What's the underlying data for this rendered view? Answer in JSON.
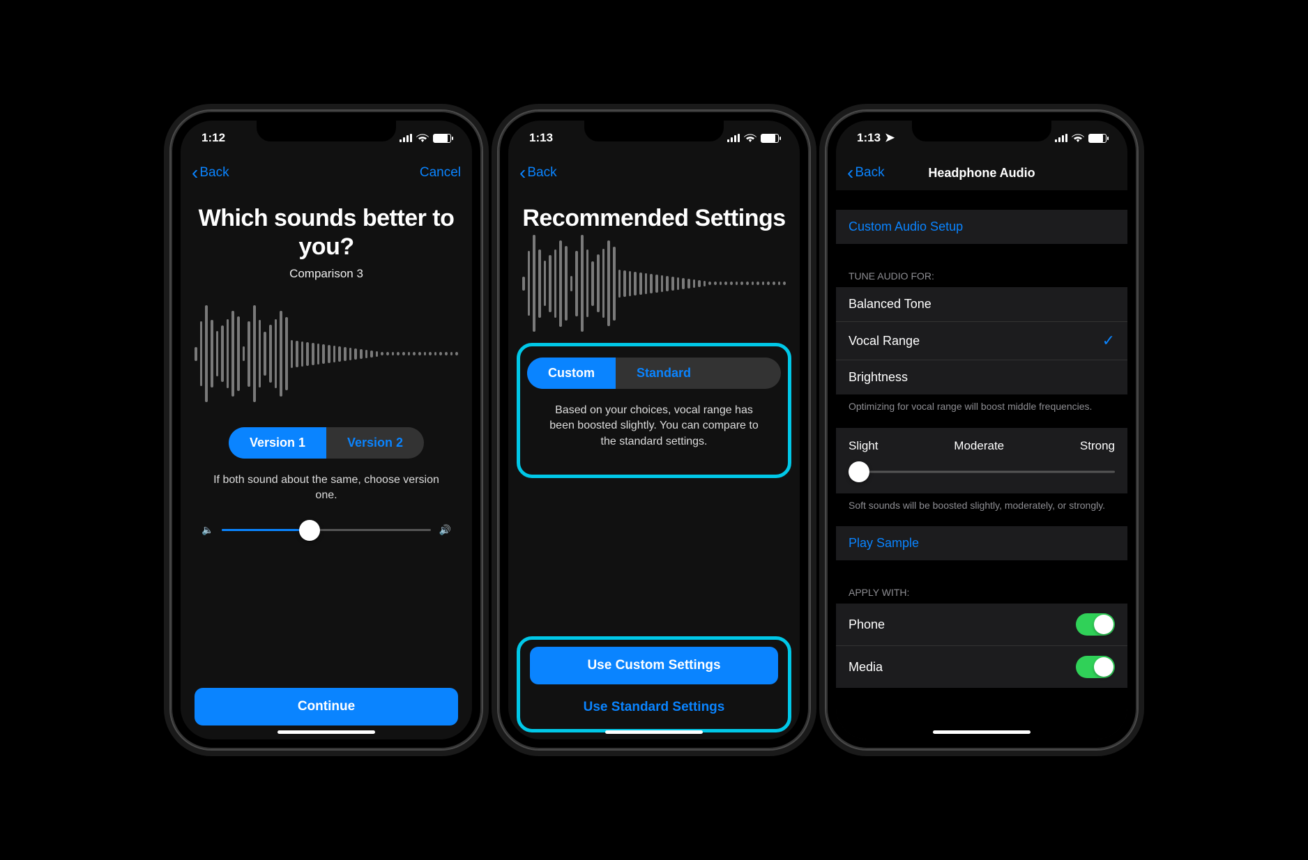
{
  "screen1": {
    "time": "1:12",
    "back": "Back",
    "cancel": "Cancel",
    "title": "Which sounds better to you?",
    "subtitle": "Comparison 3",
    "seg_a": "Version 1",
    "seg_b": "Version 2",
    "hint": "If both sound about the same, choose version one.",
    "volume_percent": 42,
    "continue": "Continue"
  },
  "screen2": {
    "time": "1:13",
    "back": "Back",
    "title": "Recommended Settings",
    "seg_a": "Custom",
    "seg_b": "Standard",
    "desc": "Based on your choices, vocal range has been boosted slightly. You can compare to the standard settings.",
    "btn_primary": "Use Custom Settings",
    "btn_secondary": "Use Standard Settings"
  },
  "screen3": {
    "time": "1:13",
    "back": "Back",
    "title": "Headphone Audio",
    "custom_setup": "Custom Audio Setup",
    "tune_header": "TUNE AUDIO FOR:",
    "tune_options": {
      "a": "Balanced Tone",
      "b": "Vocal Range",
      "c": "Brightness"
    },
    "tune_selected": "Vocal Range",
    "tune_footer": "Optimizing for vocal range will boost middle frequencies.",
    "strength": {
      "a": "Slight",
      "b": "Moderate",
      "c": "Strong"
    },
    "strength_value": 0,
    "strength_footer": "Soft sounds will be boosted slightly, moderately, or strongly.",
    "play_sample": "Play Sample",
    "apply_header": "APPLY WITH:",
    "apply": {
      "phone": "Phone",
      "media": "Media"
    },
    "phone_on": true,
    "media_on": true
  }
}
